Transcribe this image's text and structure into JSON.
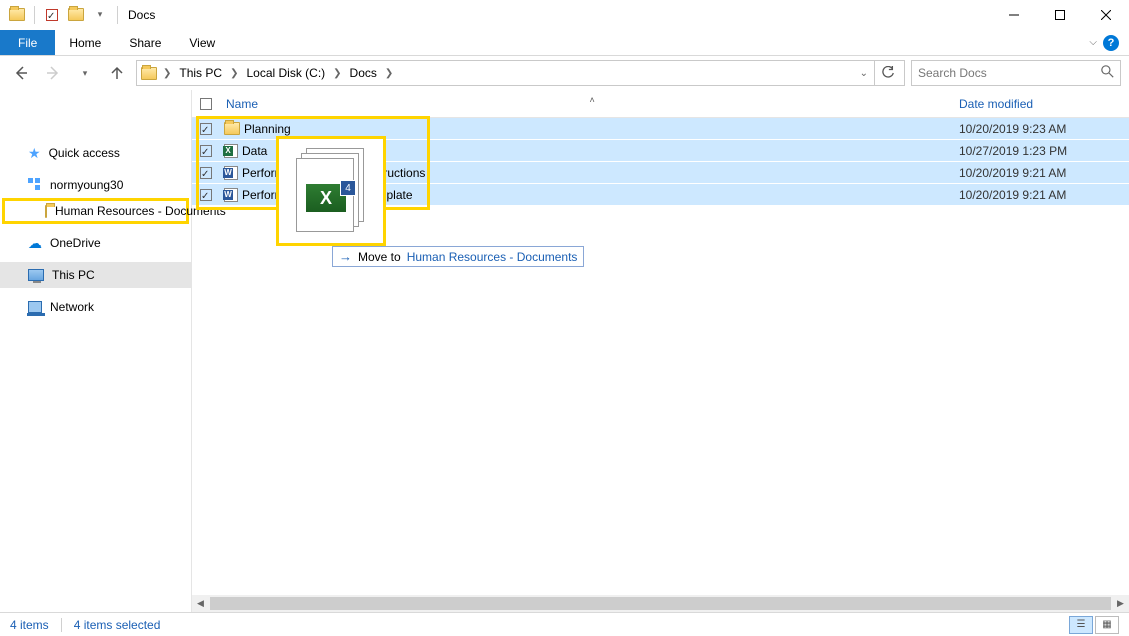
{
  "window": {
    "title": "Docs"
  },
  "menus": {
    "file": "File",
    "home": "Home",
    "share": "Share",
    "view": "View"
  },
  "breadcrumb": {
    "items": [
      "This PC",
      "Local Disk (C:)",
      "Docs"
    ]
  },
  "search": {
    "placeholder": "Search Docs"
  },
  "columns": {
    "name": "Name",
    "date": "Date modified"
  },
  "sidebar": {
    "quick_access": "Quick access",
    "norm": "normyoung30",
    "hr": "Human Resources - Documents",
    "onedrive": "OneDrive",
    "thispc": "This PC",
    "network": "Network"
  },
  "files": [
    {
      "name": "Planning",
      "type": "folder",
      "date": "10/20/2019 9:23 AM",
      "checked": true
    },
    {
      "name": "Data",
      "type": "excel",
      "date": "10/27/2019 1:23 PM",
      "checked": true
    },
    {
      "name": "Performance Review - Instructions",
      "type": "word",
      "date": "10/20/2019 9:21 AM",
      "checked": true
    },
    {
      "name": "Performance Review - Template",
      "type": "word",
      "date": "10/20/2019 9:21 AM",
      "checked": true
    }
  ],
  "drag": {
    "badge_count": "4",
    "tooltip_prefix": "Move to ",
    "tooltip_target": "Human Resources - Documents"
  },
  "status": {
    "count": "4 items",
    "selected": "4 items selected"
  }
}
